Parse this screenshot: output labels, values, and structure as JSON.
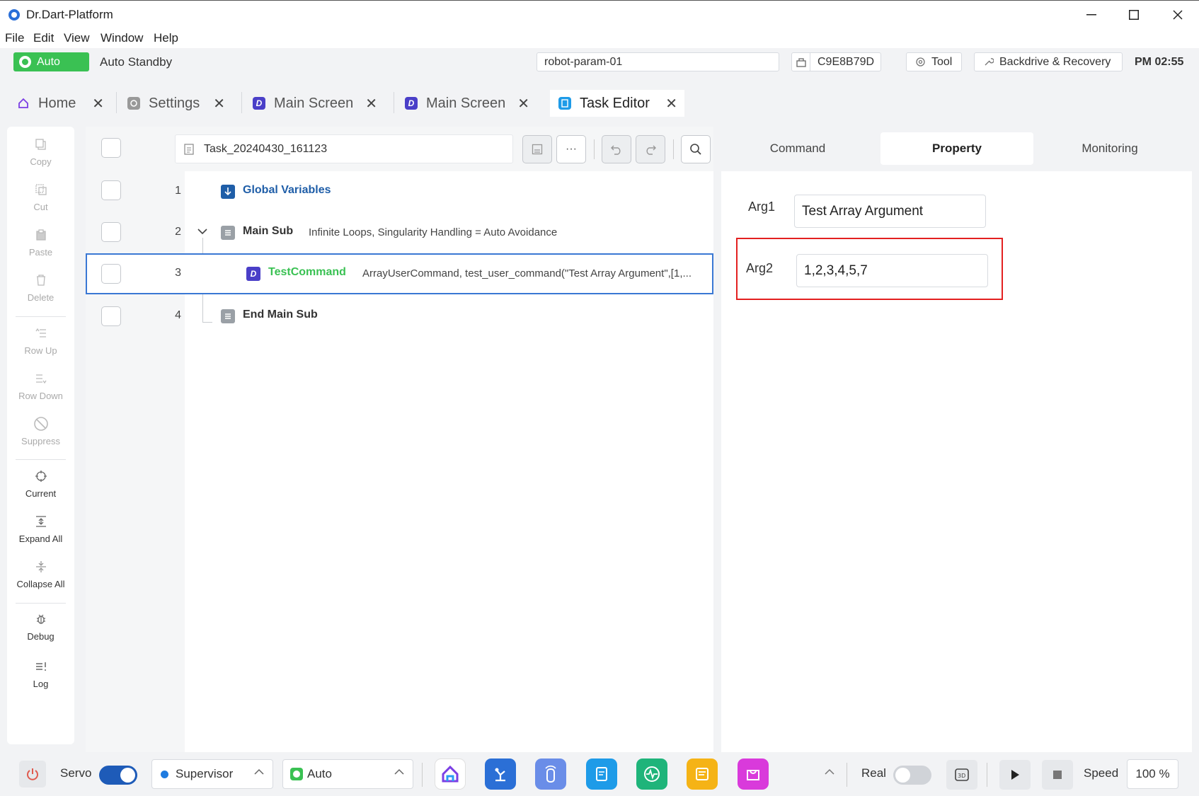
{
  "window": {
    "title": "Dr.Dart-Platform",
    "minimize": "–",
    "maximize": "☐",
    "close": "✕"
  },
  "menu": [
    "File",
    "Edit",
    "View",
    "Window",
    "Help"
  ],
  "status": {
    "mode_badge": "Auto",
    "state": "Auto Standby",
    "robot_param": "robot-param-01",
    "device_id": "C9E8B79D",
    "tool_label": "Tool",
    "backdrive_label": "Backdrive & Recovery",
    "time": "PM 02:55"
  },
  "tabs": [
    {
      "label": "Home",
      "icon": "home-icon"
    },
    {
      "label": "Settings",
      "icon": "settings-icon"
    },
    {
      "label": "Main Screen",
      "icon": "dart-icon"
    },
    {
      "label": "Main Screen",
      "icon": "dart-icon"
    },
    {
      "label": "Task Editor",
      "icon": "task-editor-icon",
      "active": true
    }
  ],
  "tools": [
    {
      "label": "Copy",
      "enabled": false
    },
    {
      "label": "Cut",
      "enabled": false
    },
    {
      "label": "Paste",
      "enabled": false
    },
    {
      "label": "Delete",
      "enabled": false
    },
    {
      "label": "Row Up",
      "enabled": false
    },
    {
      "label": "Row Down",
      "enabled": false
    },
    {
      "label": "Suppress",
      "enabled": false
    },
    {
      "label": "Current",
      "enabled": true
    },
    {
      "label": "Expand All",
      "enabled": true
    },
    {
      "label": "Collapse All",
      "enabled": true
    },
    {
      "label": "Debug",
      "enabled": true
    },
    {
      "label": "Log",
      "enabled": true
    }
  ],
  "editor": {
    "task_name": "Task_20240430_161123",
    "rows": [
      {
        "num": "1",
        "label": "Global Variables",
        "desc": ""
      },
      {
        "num": "2",
        "label": "Main Sub",
        "desc": "Infinite Loops, Singularity Handling = Auto Avoidance"
      },
      {
        "num": "3",
        "label": "TestCommand",
        "desc": "ArrayUserCommand, test_user_command(\"Test Array Argument\",[1,..."
      },
      {
        "num": "4",
        "label": "End Main Sub",
        "desc": ""
      }
    ]
  },
  "panel": {
    "tabs": [
      "Command",
      "Property",
      "Monitoring"
    ],
    "active_tab": "Property",
    "args": [
      {
        "label": "Arg1",
        "value": "Test Array Argument"
      },
      {
        "label": "Arg2",
        "value": "1,2,3,4,5,7"
      }
    ]
  },
  "bottom": {
    "servo_label": "Servo",
    "servo_on": true,
    "user_level": "Supervisor",
    "mode": "Auto",
    "real_label": "Real",
    "real_on": false,
    "speed_label": "Speed",
    "speed_value": "100 %"
  },
  "colors": {
    "accent": "#3a78d4",
    "auto_green": "#3ac153",
    "highlight_red": "#e32020",
    "command_green": "#3ac153",
    "global_blue": "#1f5ea8"
  }
}
